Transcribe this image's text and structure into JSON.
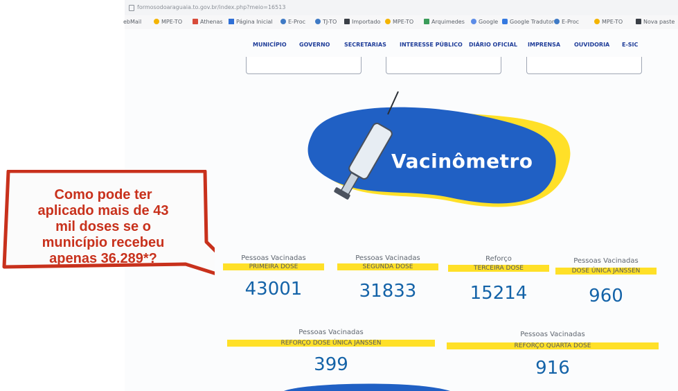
{
  "browser": {
    "url": "formosodoaraguaia.to.gov.br/index.php?meio=16513",
    "bookmarks": [
      "ebMail",
      "MPE-TO",
      "Athenas",
      "Página Inicial",
      "E-Proc",
      "TJ-TO",
      "Importado",
      "MPE-TO",
      "Arquimedes",
      "Google",
      "Google Tradutor",
      "E-Proc",
      "MPE-TO",
      "Nova paste"
    ]
  },
  "nav": {
    "items": [
      "MUNICÍPIO",
      "GOVERNO",
      "SECRETARIAS",
      "INTERESSE PÚBLICO",
      "DIÁRIO OFICIAL",
      "IMPRENSA",
      "OUVIDORIA",
      "E-SIC"
    ]
  },
  "hero": {
    "title": "Vacinômetro"
  },
  "stats": [
    {
      "label": "Pessoas Vacinadas",
      "band": "PRIMEIRA DOSE",
      "value": "43001"
    },
    {
      "label": "Pessoas Vacinadas",
      "band": "SEGUNDA DOSE",
      "value": "31833"
    },
    {
      "label": "Reforço",
      "band": "TERCEIRA DOSE",
      "value": "15214"
    },
    {
      "label": "Pessoas Vacinadas",
      "band": "DOSE ÚNICA JANSSEN",
      "value": "960"
    },
    {
      "label": "Pessoas Vacinadas",
      "band": "REFORÇO DOSE ÚNICA JANSSEN",
      "value": "399"
    },
    {
      "label": "Pessoas Vacinadas",
      "band": "REFORÇO QUARTA DOSE",
      "value": "916"
    }
  ],
  "callout": {
    "lines": [
      "Como pode ter",
      "aplicado mais de 43",
      "mil doses se o",
      "município recebeu",
      "apenas 36.289*?"
    ]
  },
  "colors": {
    "accent": "#1f5fbf",
    "band": "#ffe028",
    "value": "#1463a8",
    "callout": "#c8311c"
  }
}
